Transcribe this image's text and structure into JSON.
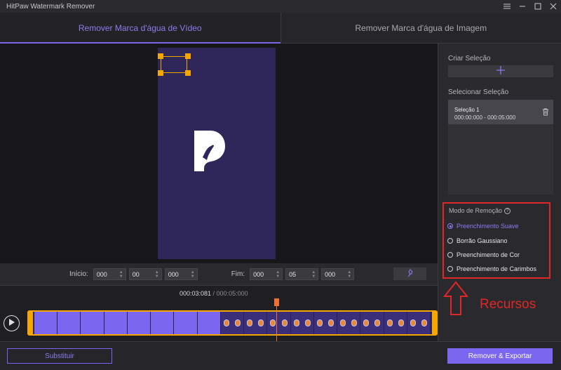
{
  "window": {
    "title": "HitPaw Watermark Remover"
  },
  "window_controls": [
    "menu-icon",
    "minimize-icon",
    "maximize-icon",
    "close-icon"
  ],
  "tabs": [
    {
      "label": "Remover Marca d'água de Vídeo",
      "active": true
    },
    {
      "label": "Remover Marca d'água de Imagem",
      "active": false
    }
  ],
  "time_range": {
    "start_label": "Início:",
    "start": [
      "000",
      "00",
      "000"
    ],
    "end_label": "Fim:",
    "end": [
      "000",
      "05",
      "000"
    ]
  },
  "timeline": {
    "current": "000:03:081",
    "total": " / 000:05:000",
    "playhead_fraction": 0.61
  },
  "right_panel": {
    "create_selection_label": "Criar Seleção",
    "select_selection_label": "Selecionar Seleção",
    "selection": {
      "name": "Seleção 1",
      "range": "000:00:000 - 000:05:000"
    },
    "removal_mode": {
      "title": "Modo de Remoção",
      "options": [
        {
          "label": "Preenchimento Suave",
          "selected": true
        },
        {
          "label": "Borrão Gaussiano",
          "selected": false
        },
        {
          "label": "Preenchimento de Cor",
          "selected": false
        },
        {
          "label": "Preenchimento de Carimbos",
          "selected": false
        }
      ]
    }
  },
  "buttons": {
    "replace": "Substituir",
    "export": "Remover & Exportar"
  },
  "annotation": {
    "label": "Recursos",
    "color": "#e02626"
  },
  "colors": {
    "accent": "#7b66f0",
    "selection_handle": "#f5a700",
    "playhead": "#f07030"
  }
}
